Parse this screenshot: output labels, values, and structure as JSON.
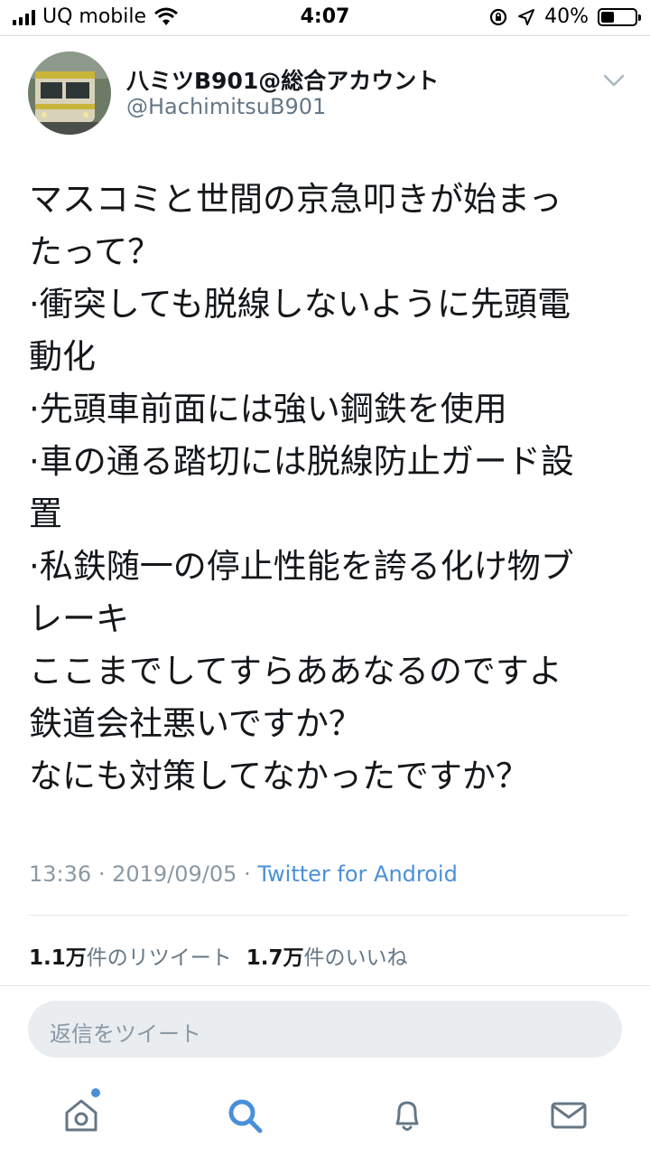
{
  "status_bar": {
    "carrier": "UQ mobile",
    "time": "4:07",
    "battery_percent": "40%",
    "battery_level": 0.4
  },
  "tweet": {
    "display_name": "八ミツB901@総合アカウント",
    "handle": "@HachimitsuB901",
    "lines": [
      "マスコミと世間の京急叩きが始まっ",
      "たって？",
      "·衝突しても脱線しないように先頭電",
      "動化",
      "·先頭車前面には強い鋼鉄を使用",
      "·車の通る踏切には脱線防止ガード設",
      "置",
      "·私鉄随一の停止性能を誇る化け物ブ",
      "レーキ",
      "ここまでしてすらああなるのですよ",
      "鉄道会社悪いですか？",
      "なにも対策してなかったですか？"
    ],
    "time": "13:36",
    "date": "2019/09/05",
    "separator": "·",
    "source": "Twitter for Android"
  },
  "stats": {
    "retweet_count": "1.1万",
    "retweet_label": "件のリツイート",
    "like_count": "1.7万",
    "like_label": "件のいいね"
  },
  "reply": {
    "placeholder": "返信をツイート"
  },
  "tabbar": {
    "items": [
      "home-icon",
      "search-icon",
      "notifications-icon",
      "messages-icon"
    ],
    "active": "search-icon",
    "accent": "#4a90d9"
  }
}
